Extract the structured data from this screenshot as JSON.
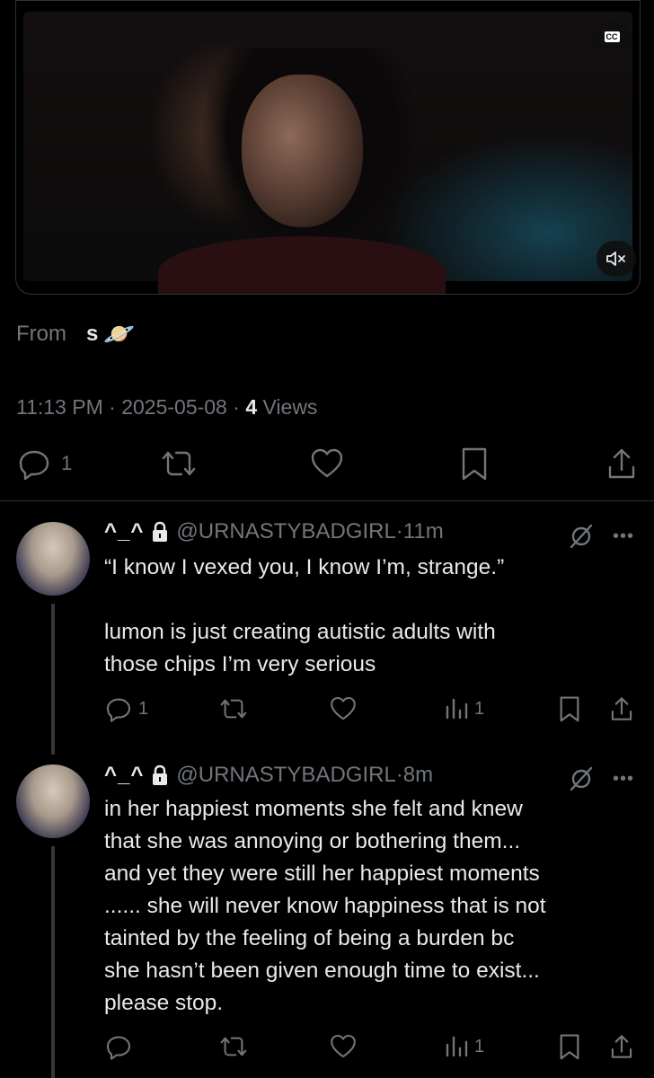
{
  "video": {
    "cc_label": "CC",
    "mute_icon": "speaker-muted-icon"
  },
  "source": {
    "prefix": "From",
    "name": "s",
    "emoji": "🪐"
  },
  "meta": {
    "time": "11:13 PM",
    "sep1": " · ",
    "date": "2025-05-08",
    "sep2": " · ",
    "views_count": "4",
    "views_label": " Views"
  },
  "actions": {
    "reply_count": "1"
  },
  "replies": [
    {
      "display_name": "^_^",
      "handle": "@URNASTYBADGIRL",
      "sep": " · ",
      "time": "11m",
      "text": "“I know I vexed you, I know I’m, strange.”\n\nlumon is just creating autistic adults with\nthose chips I’m very serious",
      "reply_count": "1",
      "view_count": "1"
    },
    {
      "display_name": "^_^",
      "handle": "@URNASTYBADGIRL",
      "sep": " · ",
      "time": "8m",
      "text": "in her happiest moments she felt and knew\nthat she was annoying or bothering them...\nand yet they were still her happiest moments\n...... she will never know happiness that is not\ntainted by the feeling of being a burden bc\nshe hasn’t been given enough time to exist...\nplease stop.",
      "reply_count": "",
      "view_count": "1"
    }
  ]
}
